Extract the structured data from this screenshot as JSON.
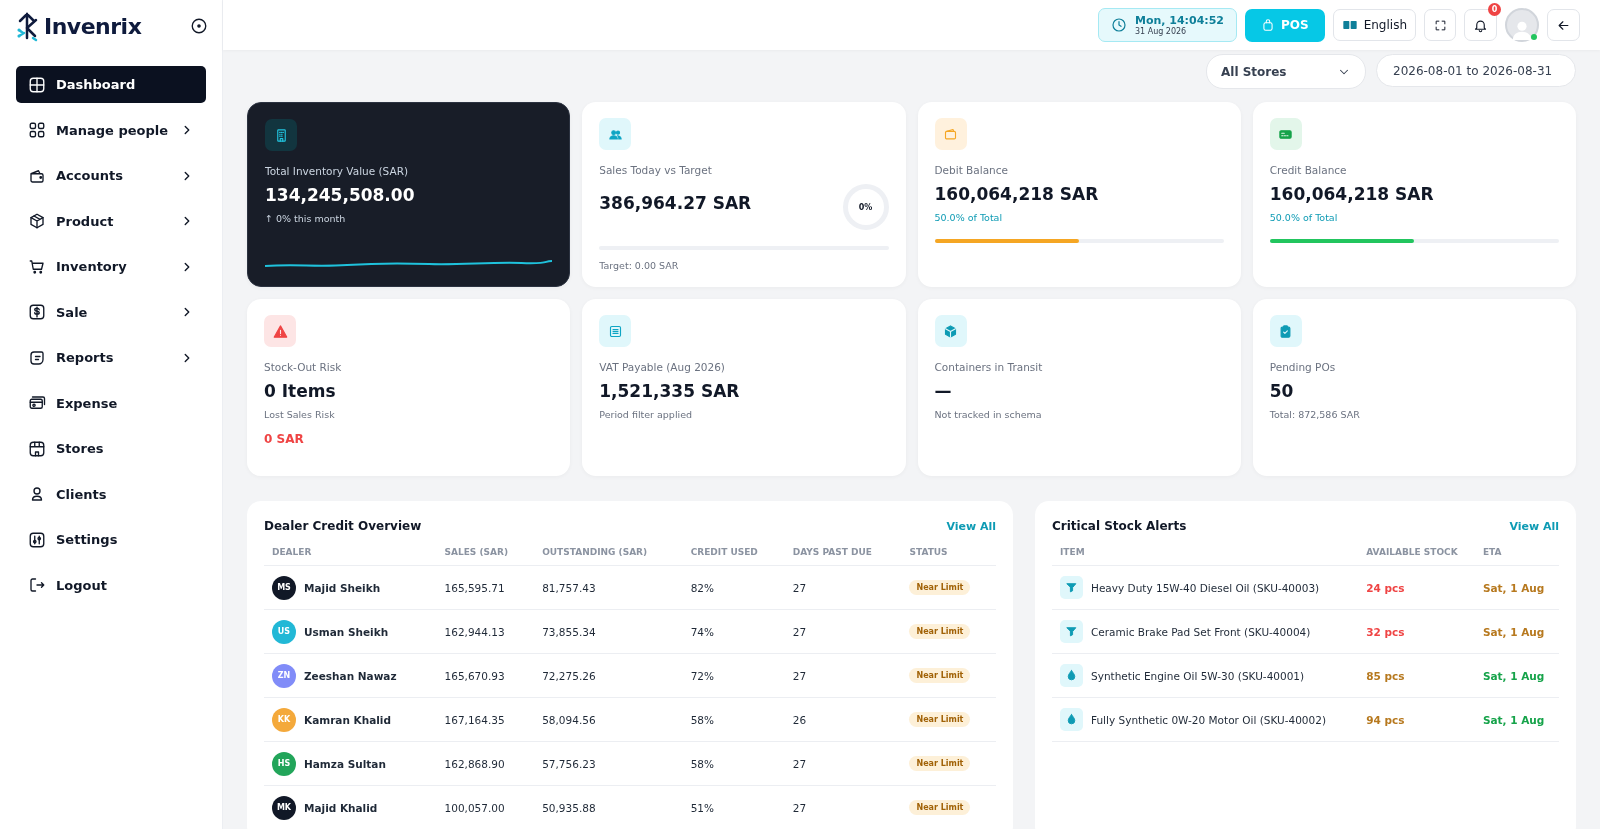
{
  "brand": {
    "name": "Invenrix"
  },
  "sidebar": {
    "items": [
      {
        "label": "Dashboard",
        "expandable": false,
        "selected": true
      },
      {
        "label": "Manage people",
        "expandable": true,
        "selected": false
      },
      {
        "label": "Accounts",
        "expandable": true,
        "selected": false
      },
      {
        "label": "Product",
        "expandable": true,
        "selected": false
      },
      {
        "label": "Inventory",
        "expandable": true,
        "selected": false
      },
      {
        "label": "Sale",
        "expandable": true,
        "selected": false
      },
      {
        "label": "Reports",
        "expandable": true,
        "selected": false
      },
      {
        "label": "Expense",
        "expandable": false,
        "selected": false
      },
      {
        "label": "Stores",
        "expandable": false,
        "selected": false
      },
      {
        "label": "Clients",
        "expandable": false,
        "selected": false
      },
      {
        "label": "Settings",
        "expandable": false,
        "selected": false
      },
      {
        "label": "Logout",
        "expandable": false,
        "selected": false
      }
    ]
  },
  "header": {
    "clock": {
      "time": "Mon, 14:04:52",
      "date": "31 Aug 2026"
    },
    "pos_button": "POS",
    "language": "English",
    "notifications": {
      "badge": "0"
    },
    "user": {
      "online": true
    }
  },
  "filters": {
    "store": "All Stores",
    "date_range": "2026-08-01 to 2026-08-31"
  },
  "cards": [
    {
      "kind": "dark",
      "label": "Total Inventory Value (SAR)",
      "value": "134,245,508.00",
      "note": "↑ 0% this month"
    },
    {
      "kind": "ring",
      "label": "Sales Today vs Target",
      "value": "386,964.27 SAR",
      "ring_text": "0%",
      "level": 0,
      "note": "Target: 0.00 SAR"
    },
    {
      "kind": "bar",
      "label": "Debit Balance",
      "value": "160,064,218 SAR",
      "note": "50.0% of Total",
      "level": 0.5,
      "color": "#f5a623"
    },
    {
      "kind": "bar",
      "label": "Credit Balance",
      "value": "160,064,218 SAR",
      "note": "50.0% of Total",
      "level": 0.5,
      "color": "#22c55e"
    },
    {
      "kind": "risk",
      "label": "Stock-Out Risk",
      "value": "0 Items",
      "note": "Lost Sales Risk",
      "extra": "0 SAR"
    },
    {
      "kind": "plain",
      "label": "VAT Payable (Aug 2026)",
      "value": "1,521,335 SAR",
      "note": "Period filter applied"
    },
    {
      "kind": "plain",
      "label": "Containers in Transit",
      "value": "—",
      "note": "Not tracked in schema"
    },
    {
      "kind": "plain",
      "label": "Pending POs",
      "value": "50",
      "note": "Total: 872,586 SAR"
    }
  ],
  "dealer_credit": {
    "title": "Dealer Credit Overview",
    "view_all": "View All",
    "columns": [
      "DEALER",
      "SALES (SAR)",
      "OUTSTANDING (SAR)",
      "CREDIT USED",
      "DAYS PAST DUE",
      "STATUS"
    ],
    "rows": [
      {
        "initials": "MS",
        "color": "#111827",
        "name": "Majid Sheikh",
        "sales": "165,595.71",
        "outstanding": "81,757.43",
        "credit_used": "82%",
        "days": "27",
        "status": "Near Limit"
      },
      {
        "initials": "US",
        "color": "#22b8d6",
        "name": "Usman Sheikh",
        "sales": "162,944.13",
        "outstanding": "73,855.34",
        "credit_used": "74%",
        "days": "27",
        "status": "Near Limit"
      },
      {
        "initials": "ZN",
        "color": "#818cf8",
        "name": "Zeeshan Nawaz",
        "sales": "165,670.93",
        "outstanding": "72,275.26",
        "credit_used": "72%",
        "days": "27",
        "status": "Near Limit"
      },
      {
        "initials": "KK",
        "color": "#f4a93b",
        "name": "Kamran Khalid",
        "sales": "167,164.35",
        "outstanding": "58,094.56",
        "credit_used": "58%",
        "days": "26",
        "status": "Near Limit"
      },
      {
        "initials": "HS",
        "color": "#22a55a",
        "name": "Hamza Sultan",
        "sales": "162,868.90",
        "outstanding": "57,756.23",
        "credit_used": "58%",
        "days": "27",
        "status": "Near Limit"
      },
      {
        "initials": "MK",
        "color": "#111827",
        "name": "Majid Khalid",
        "sales": "100,057.00",
        "outstanding": "50,935.88",
        "credit_used": "51%",
        "days": "27",
        "status": "Near Limit"
      }
    ]
  },
  "stock_alerts": {
    "title": "Critical Stock Alerts",
    "view_all": "View All",
    "columns": [
      "ITEM",
      "AVAILABLE STOCK",
      "ETA"
    ],
    "rows": [
      {
        "kind": "filter",
        "item": "Heavy Duty 15W-40 Diesel Oil (SKU-40003)",
        "stock": {
          "text": "24 pcs",
          "color": "#ef4444"
        },
        "eta": {
          "text": "Sat, 1 Aug",
          "color": "#b7791f"
        }
      },
      {
        "kind": "filter",
        "item": "Ceramic Brake Pad Set Front (SKU-40004)",
        "stock": {
          "text": "32 pcs",
          "color": "#ef4444"
        },
        "eta": {
          "text": "Sat, 1 Aug",
          "color": "#b7791f"
        }
      },
      {
        "kind": "drop",
        "item": "Synthetic Engine Oil 5W-30 (SKU-40001)",
        "stock": {
          "text": "85 pcs",
          "color": "#b7791f"
        },
        "eta": {
          "text": "Sat, 1 Aug",
          "color": "#16a34a"
        }
      },
      {
        "kind": "drop",
        "item": "Fully Synthetic 0W-20 Motor Oil (SKU-40002)",
        "stock": {
          "text": "94 pcs",
          "color": "#b7791f"
        },
        "eta": {
          "text": "Sat, 1 Aug",
          "color": "#16a34a"
        }
      }
    ]
  }
}
